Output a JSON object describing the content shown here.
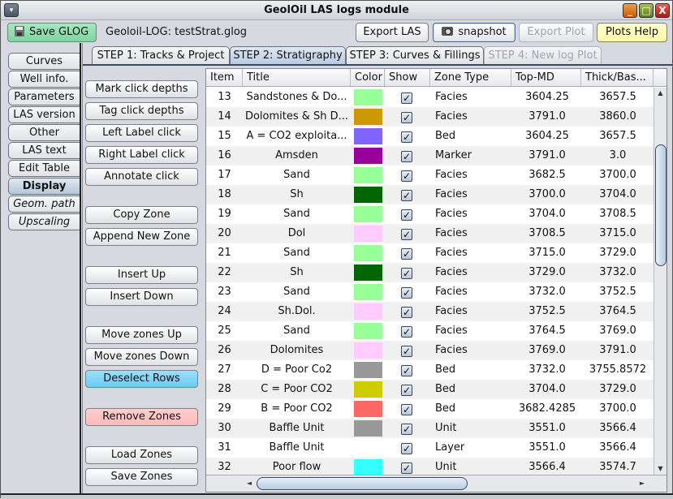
{
  "window": {
    "title": "GeolOil LAS logs module",
    "controls": {
      "minimize": "_",
      "maximize": "□",
      "close": "X",
      "menu": "▾"
    }
  },
  "toolbar": {
    "save_label": "Save GLOG",
    "file_label": "Geoloil-LOG: testStrat.glog",
    "export_las_label": "Export LAS",
    "snapshot_label": "snapshot",
    "export_plot_label": "Export Plot",
    "plots_help_label": "Plots Help"
  },
  "side_tabs": [
    {
      "label": "Curves",
      "active": false
    },
    {
      "label": "Well info.",
      "active": false
    },
    {
      "label": "Parameters",
      "active": false
    },
    {
      "label": "LAS version",
      "active": false
    },
    {
      "label": "Other",
      "active": false
    },
    {
      "label": "LAS text",
      "active": false
    },
    {
      "label": "Edit Table",
      "active": false
    },
    {
      "label": "Display",
      "active": true
    },
    {
      "label": "Geom. path",
      "active": false
    },
    {
      "label": "Upscaling",
      "active": false
    }
  ],
  "step_tabs": [
    {
      "label": "STEP 1: Tracks & Project",
      "state": "normal"
    },
    {
      "label": "STEP 2: Stratigraphy",
      "state": "active"
    },
    {
      "label": "STEP 3: Curves & Fillings",
      "state": "normal"
    },
    {
      "label": "STEP 4: New log Plot",
      "state": "disabled"
    }
  ],
  "action_buttons": {
    "mark_click_depths": "Mark click depths",
    "tag_click_depths": "Tag click depths",
    "left_label_click": "Left Label click",
    "right_label_click": "Right Label click",
    "annotate_click": "Annotate click",
    "copy_zone": "Copy Zone",
    "append_new_zone": "Append New Zone",
    "insert_up": "Insert Up",
    "insert_down": "Insert Down",
    "move_zones_up": "Move zones Up",
    "move_zones_down": "Move zones Down",
    "deselect_rows": "Deselect Rows",
    "remove_zones": "Remove Zones",
    "load_zones": "Load Zones",
    "save_zones": "Save Zones"
  },
  "table": {
    "columns": [
      "Item",
      "Title",
      "Color",
      "Show",
      "Zone Type",
      "Top-MD",
      "Thick/Bas..."
    ],
    "rows": [
      {
        "item": "13",
        "title": "Sandstones & Do...",
        "color": "#99ff99",
        "show": true,
        "type": "Facies",
        "top": "3604.25",
        "base": "3657.5"
      },
      {
        "item": "14",
        "title": "Dolomites & Sh D...",
        "color": "#cc9900",
        "show": true,
        "type": "Facies",
        "top": "3791.0",
        "base": "3860.0"
      },
      {
        "item": "15",
        "title": "A = CO2 exploita...",
        "color": "#8066ff",
        "show": true,
        "type": "Bed",
        "top": "3604.25",
        "base": "3657.5"
      },
      {
        "item": "16",
        "title": "Amsden",
        "color": "#990099",
        "show": true,
        "type": "Marker",
        "top": "3791.0",
        "base": "3.0"
      },
      {
        "item": "17",
        "title": "Sand",
        "color": "#99ff99",
        "show": true,
        "type": "Facies",
        "top": "3682.5",
        "base": "3700.0"
      },
      {
        "item": "18",
        "title": "Sh",
        "color": "#006600",
        "show": true,
        "type": "Facies",
        "top": "3700.0",
        "base": "3704.0"
      },
      {
        "item": "19",
        "title": "Sand",
        "color": "#99ff99",
        "show": true,
        "type": "Facies",
        "top": "3704.0",
        "base": "3708.5"
      },
      {
        "item": "20",
        "title": "Dol",
        "color": "#ffccff",
        "show": true,
        "type": "Facies",
        "top": "3708.5",
        "base": "3715.0"
      },
      {
        "item": "21",
        "title": "Sand",
        "color": "#99ff99",
        "show": true,
        "type": "Facies",
        "top": "3715.0",
        "base": "3729.0"
      },
      {
        "item": "22",
        "title": "Sh",
        "color": "#006600",
        "show": true,
        "type": "Facies",
        "top": "3729.0",
        "base": "3732.0"
      },
      {
        "item": "23",
        "title": "Sand",
        "color": "#99ff99",
        "show": true,
        "type": "Facies",
        "top": "3732.0",
        "base": "3752.5"
      },
      {
        "item": "24",
        "title": "Sh.Dol.",
        "color": "#ffccff",
        "show": true,
        "type": "Facies",
        "top": "3752.5",
        "base": "3764.5"
      },
      {
        "item": "25",
        "title": "Sand",
        "color": "#99ff99",
        "show": true,
        "type": "Facies",
        "top": "3764.5",
        "base": "3769.0"
      },
      {
        "item": "26",
        "title": "Dolomites",
        "color": "#ffccff",
        "show": true,
        "type": "Facies",
        "top": "3769.0",
        "base": "3791.0"
      },
      {
        "item": "27",
        "title": "D = Poor Co2",
        "color": "#999999",
        "show": true,
        "type": "Bed",
        "top": "3732.0",
        "base": "3755.8572"
      },
      {
        "item": "28",
        "title": "C = Poor CO2",
        "color": "#cccc00",
        "show": true,
        "type": "Bed",
        "top": "3704.0",
        "base": "3729.0"
      },
      {
        "item": "29",
        "title": "B = Poor CO2",
        "color": "#ff6666",
        "show": true,
        "type": "Bed",
        "top": "3682.4285",
        "base": "3700.0"
      },
      {
        "item": "30",
        "title": "Baffle Unit",
        "color": "#999999",
        "show": true,
        "type": "Unit",
        "top": "3551.0",
        "base": "3566.4"
      },
      {
        "item": "31",
        "title": "Baffle Unit",
        "color": "",
        "show": true,
        "type": "Layer",
        "top": "3551.0",
        "base": "3566.4"
      },
      {
        "item": "32",
        "title": "Poor flow",
        "color": "#33ffff",
        "show": true,
        "type": "Unit",
        "top": "3566.4",
        "base": "3574.7"
      }
    ]
  },
  "scrollbars": {
    "up": "▲",
    "down": "▼",
    "left": "◄",
    "right": "►"
  }
}
